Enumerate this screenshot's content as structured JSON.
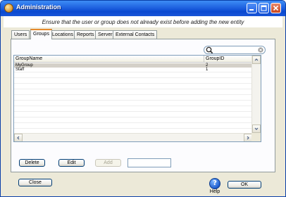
{
  "window": {
    "title": "Administration"
  },
  "banner": {
    "text": "Ensure that the user or group does not already exist before adding the new entity"
  },
  "tabs": [
    {
      "label": "Users"
    },
    {
      "label": "Groups"
    },
    {
      "label": "Locations"
    },
    {
      "label": "Reports"
    },
    {
      "label": "Server"
    },
    {
      "label": "External Contacts"
    }
  ],
  "active_tab": "Groups",
  "search": {
    "value": "",
    "icon": "magnifier"
  },
  "table": {
    "columns": [
      "GroupName",
      "GroupID"
    ],
    "rows": [
      {
        "name": "MyGroup",
        "id": "2",
        "selected": true
      },
      {
        "name": "Staff",
        "id": "1",
        "selected": false
      }
    ]
  },
  "actions": {
    "delete": "Delete",
    "edit": "Edit",
    "add": "Add",
    "new_name_value": ""
  },
  "footer": {
    "close": "Close",
    "help": "Help",
    "ok": "OK"
  },
  "colors": {
    "titlebar": "#1f62e0",
    "active_tab_accent": "#e68b2c",
    "selected_row": "#d4d0c8",
    "dialog_bg": "#ece9d8"
  }
}
